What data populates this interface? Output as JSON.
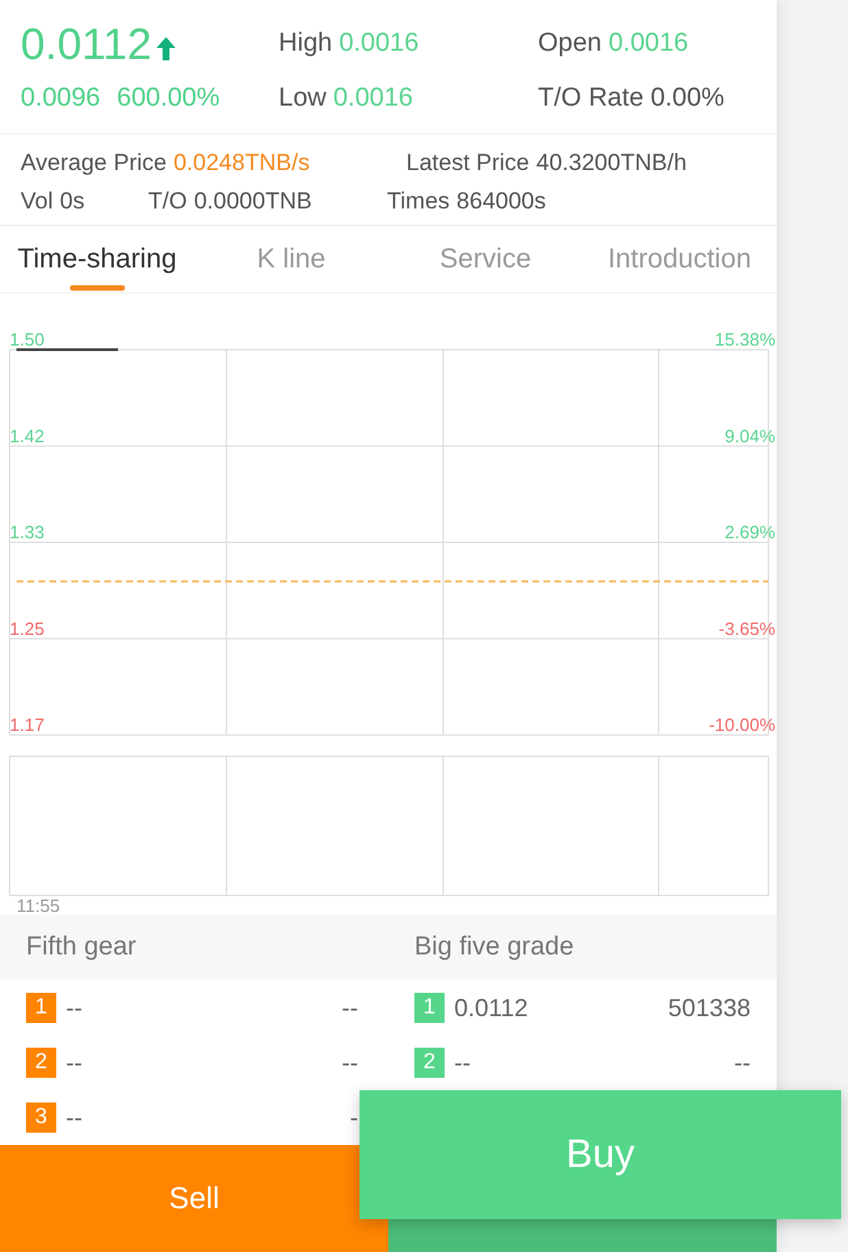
{
  "quote": {
    "price": "0.0112",
    "rising": true,
    "change": "0.0096",
    "change_percent": "600.00%"
  },
  "stats": [
    {
      "label": "High",
      "value": "0.0016",
      "kind": "highlight"
    },
    {
      "label": "Open",
      "value": "0.0016",
      "kind": "highlight"
    },
    {
      "label": "Low",
      "value": "0.0016",
      "kind": "highlight"
    },
    {
      "label": "T/O Rate",
      "value": "0.00%",
      "kind": "plain"
    }
  ],
  "details": [
    {
      "items": [
        {
          "label": "Average Price",
          "value": "0.0248TNB/s",
          "kind": "highlight"
        },
        {
          "label": "Latest Price",
          "value": "40.3200TNB/h",
          "kind": "plain"
        }
      ]
    },
    {
      "items": [
        {
          "label": "Vol",
          "value": "0s",
          "kind": "plain"
        },
        {
          "label": "T/O",
          "value": "0.0000TNB",
          "kind": "plain"
        },
        {
          "label": "Times",
          "value": "864000s",
          "kind": "plain"
        }
      ]
    }
  ],
  "tabs": [
    {
      "label": "Time-sharing",
      "selected": true
    },
    {
      "label": "K line",
      "selected": false
    },
    {
      "label": "Service",
      "selected": false
    },
    {
      "label": "Introduction",
      "selected": false
    }
  ],
  "chart": {
    "levels": [
      {
        "price": "1.50",
        "percent": "15.38%",
        "color": "#5bd491"
      },
      {
        "price": "1.42",
        "percent": "9.04%",
        "color": "#5bd491"
      },
      {
        "price": "1.33",
        "percent": "2.69%",
        "color": "#5bd491"
      },
      {
        "price": "1.25",
        "percent": "-3.65%",
        "color": "#f26a6a"
      },
      {
        "price": "1.17",
        "percent": "-10.00%",
        "color": "#f26a6a"
      }
    ],
    "time_label": "11:55"
  },
  "order_books": [
    {
      "title": "Fifth gear",
      "color": "#ff8400",
      "rows": [
        {
          "rank": "1",
          "price": "--",
          "volume": "--"
        },
        {
          "rank": "2",
          "price": "--",
          "volume": "--"
        },
        {
          "rank": "3",
          "price": "--",
          "volume": "-"
        }
      ]
    },
    {
      "title": "Big five grade",
      "color": "#55d68a",
      "rows": [
        {
          "rank": "1",
          "price": "0.0112",
          "volume": "501338"
        },
        {
          "rank": "2",
          "price": "--",
          "volume": "--"
        }
      ]
    }
  ],
  "actions": {
    "sell": "Sell",
    "buy": "Buy"
  }
}
